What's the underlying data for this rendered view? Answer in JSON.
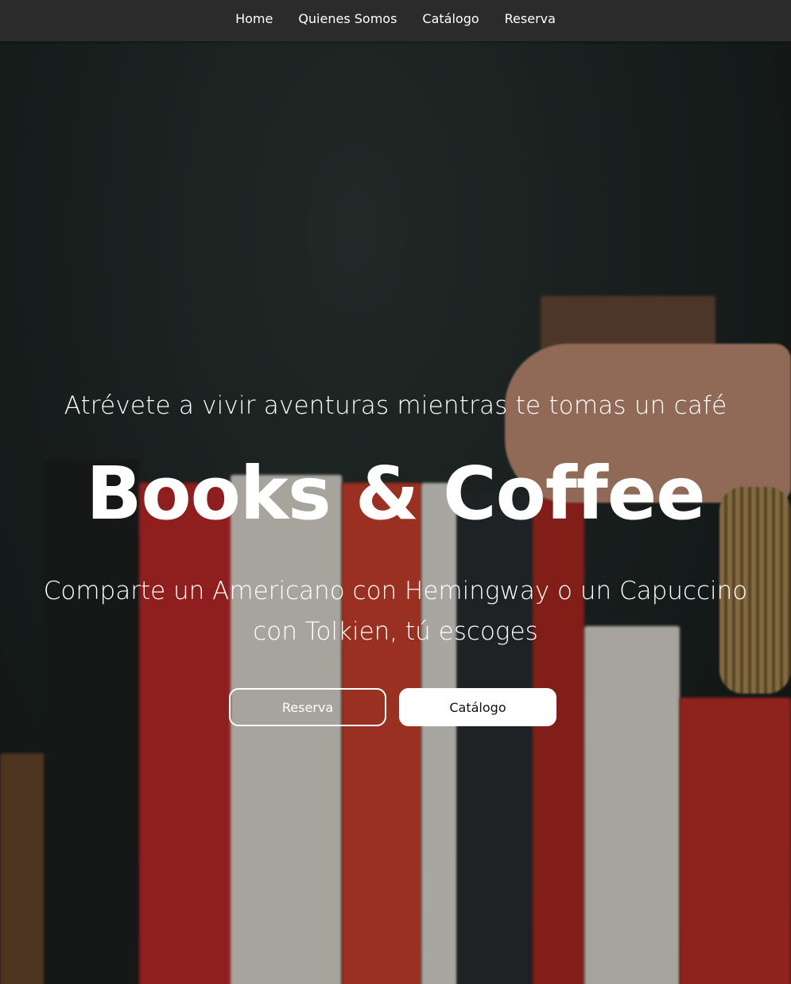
{
  "nav": {
    "items": [
      {
        "label": "Home"
      },
      {
        "label": "Quienes Somos"
      },
      {
        "label": "Catálogo"
      },
      {
        "label": "Reserva"
      }
    ]
  },
  "hero": {
    "tagline": "Atrévete a vivir aventuras mientras te tomas un café",
    "title": "Books & Coffee",
    "subtitle": "Comparte un Americano con Hemingway o un Capuccino con Tolkien, tú escoges",
    "buttons": {
      "reserva_label": "Reserva",
      "catalogo_label": "Catálogo"
    }
  },
  "colors": {
    "navbar_bg": "#2b2b2b",
    "hero_bg": "#222b29",
    "text": "#ffffff"
  }
}
